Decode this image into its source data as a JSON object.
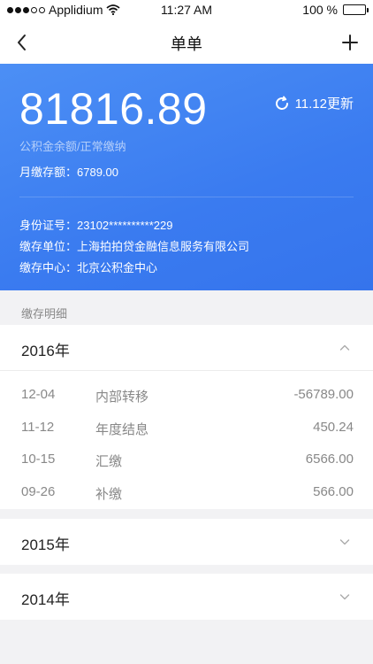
{
  "status_bar": {
    "carrier": "Applidium",
    "time": "11:27 AM",
    "battery": "100 %",
    "battery_level": 1.0,
    "icons": [
      "signal-dots-icon",
      "wifi-icon",
      "battery-icon"
    ]
  },
  "nav": {
    "title": "单单",
    "back_icon": "chevron-left-icon",
    "add_icon": "plus-icon"
  },
  "summary": {
    "balance": "81816.89",
    "balance_label": "公积金余额/正常缴纳",
    "monthly_label": "月缴存额：",
    "monthly_value": "6789.00",
    "update_text": "11.12更新",
    "update_icon": "refresh-icon",
    "background": "#3a7bf0"
  },
  "info": {
    "id_label": "身份证号：",
    "id_value": "23102**********229",
    "unit_label": "缴存单位：",
    "unit_value": "上海拍拍贷金融信息服务有限公司",
    "center_label": "缴存中心：",
    "center_value": "北京公积金中心"
  },
  "details": {
    "section_label": "缴存明细",
    "years": [
      {
        "year": "2016年",
        "expanded": true,
        "rows": [
          {
            "date": "12-04",
            "desc": "内部转移",
            "amount": "-56789.00"
          },
          {
            "date": "11-12",
            "desc": "年度结息",
            "amount": "450.24"
          },
          {
            "date": "10-15",
            "desc": "汇缴",
            "amount": "6566.00"
          },
          {
            "date": "09-26",
            "desc": "补缴",
            "amount": "566.00"
          }
        ]
      },
      {
        "year": "2015年",
        "expanded": false
      },
      {
        "year": "2014年",
        "expanded": false
      }
    ]
  }
}
